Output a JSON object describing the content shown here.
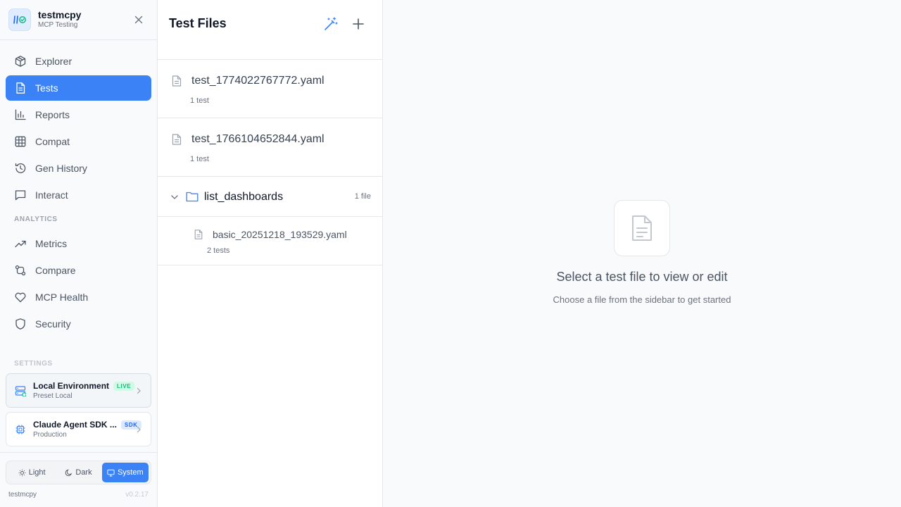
{
  "brand": {
    "name": "testmcpy",
    "subtitle": "MCP Testing"
  },
  "nav": {
    "items": [
      {
        "label": "Explorer",
        "icon": "cube-icon"
      },
      {
        "label": "Tests",
        "icon": "document-icon",
        "active": true
      },
      {
        "label": "Reports",
        "icon": "bar-chart-icon"
      },
      {
        "label": "Compat",
        "icon": "grid-icon"
      },
      {
        "label": "Gen History",
        "icon": "history-icon"
      },
      {
        "label": "Interact",
        "icon": "chat-icon"
      }
    ],
    "analytics_label": "ANALYTICS",
    "analytics_items": [
      {
        "label": "Metrics",
        "icon": "trending-up-icon"
      },
      {
        "label": "Compare",
        "icon": "compare-icon"
      },
      {
        "label": "MCP Health",
        "icon": "heart-icon"
      },
      {
        "label": "Security",
        "icon": "shield-icon"
      }
    ],
    "settings_label": "SETTINGS"
  },
  "environments": [
    {
      "title": "Local Environment",
      "badge": "LIVE",
      "subtitle": "Preset Local"
    },
    {
      "title": "Claude Agent SDK ...",
      "badge": "SDK",
      "subtitle": "Production"
    }
  ],
  "theme": {
    "light": "Light",
    "dark": "Dark",
    "system": "System",
    "selected": "System"
  },
  "footer": {
    "name": "testmcpy",
    "version": "v0.2.17"
  },
  "files_panel": {
    "title": "Test Files",
    "files": [
      {
        "name": "test_1774022767772.yaml",
        "meta": "1 test"
      },
      {
        "name": "test_1766104652844.yaml",
        "meta": "1 test"
      }
    ],
    "folder": {
      "name": "list_dashboards",
      "count": "1 file",
      "files": [
        {
          "name": "basic_20251218_193529.yaml",
          "meta": "2 tests"
        }
      ]
    }
  },
  "empty_state": {
    "title": "Select a test file to view or edit",
    "subtitle": "Choose a file from the sidebar to get started"
  },
  "colors": {
    "accent": "#3b82f6",
    "live": "#10b981",
    "sdk": "#2563eb",
    "border": "#e5e7eb"
  }
}
